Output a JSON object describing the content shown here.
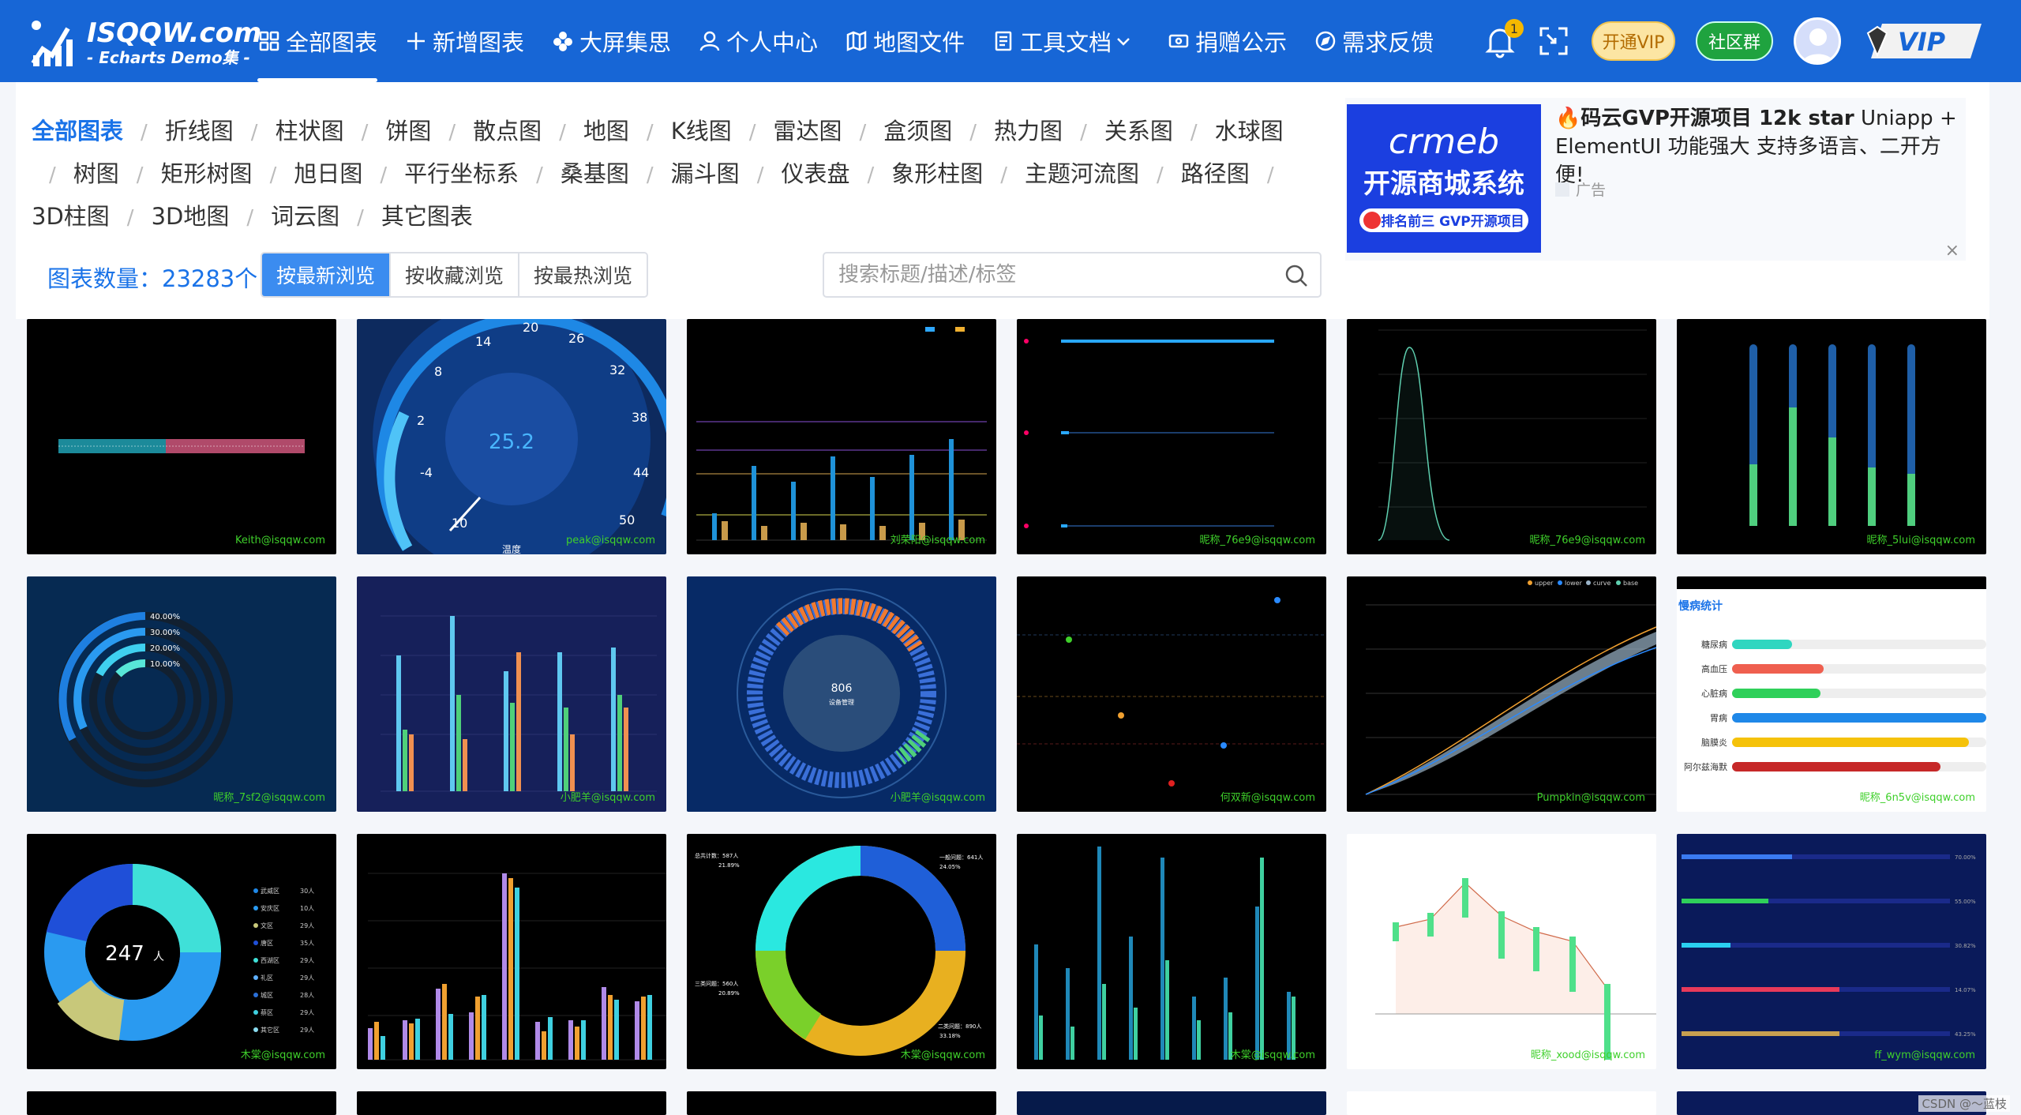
{
  "logo": {
    "title": "ISQQW.com",
    "subtitle": "- Echarts Demo集 -"
  },
  "nav": [
    {
      "label": "全部图表",
      "icon": "grid-icon"
    },
    {
      "label": "新增图表",
      "icon": "plus-icon"
    },
    {
      "label": "大屏集思",
      "icon": "cluster-icon"
    },
    {
      "label": "个人中心",
      "icon": "user-icon"
    },
    {
      "label": "地图文件",
      "icon": "map-icon"
    },
    {
      "label": "工具文档",
      "icon": "doc-icon"
    },
    {
      "label": "捐赠公示",
      "icon": "money-icon"
    },
    {
      "label": "需求反馈",
      "icon": "compass-icon"
    }
  ],
  "header_right": {
    "notif_count": "1",
    "vip_label": "开通VIP",
    "group_label": "社区群",
    "vip_badge": "VIP"
  },
  "categories": [
    "全部图表",
    "折线图",
    "柱状图",
    "饼图",
    "散点图",
    "地图",
    "K线图",
    "雷达图",
    "盒须图",
    "热力图",
    "关系图",
    "水球图",
    "树图",
    "矩形树图",
    "旭日图",
    "平行坐标系",
    "桑基图",
    "漏斗图",
    "仪表盘",
    "象形柱图",
    "主题河流图",
    "路径图",
    "3D柱图",
    "3D地图",
    "词云图",
    "其它图表"
  ],
  "count_label": "图表数量：23283个",
  "sort_tabs": [
    "按最新浏览",
    "按收藏浏览",
    "按最热浏览"
  ],
  "search": {
    "placeholder": "搜索标题/描述/标签"
  },
  "ad": {
    "title_bold": "🔥码云GVP开源项目 12k star",
    "title_rest": " Uniapp + ElementUI 功能强大 支持多语言、二开方便!",
    "label": "广告",
    "img_brand": "crmeb",
    "img_title": "开源商城系统",
    "img_sub": "排名前三 GVP开源项目",
    "close": "×"
  },
  "cards": {
    "c1": {
      "wm": "Keith@isqqw.com"
    },
    "c2": {
      "wm": "peak@isqqw.com",
      "value": "25.2",
      "ticks": [
        "2",
        "8",
        "14",
        "20",
        "26",
        "32",
        "38",
        "44",
        "50",
        "-4",
        "10"
      ],
      "unit": "温度"
    },
    "c3": {
      "wm": "刘荣阳@isqqw.com"
    },
    "c4": {
      "wm": "昵称_76e9@isqqw.com"
    },
    "c5": {
      "wm": "昵称_76e9@isqqw.com"
    },
    "c6": {
      "wm": "昵称_5lui@isqqw.com"
    },
    "c7": {
      "wm": "昵称_7sf2@isqqw.com",
      "labels": [
        "40.00%",
        "30.00%",
        "20.00%",
        "10.00%"
      ]
    },
    "c8": {
      "wm": "小肥羊@isqqw.com"
    },
    "c9": {
      "wm": "小肥羊@isqqw.com",
      "value": "806",
      "sub": "设备管理"
    },
    "c10": {
      "wm": "何双新@isqqw.com"
    },
    "c11": {
      "wm": "Pumpkin@isqqw.com",
      "legend": [
        "upper",
        "lower",
        "curve",
        "base"
      ]
    },
    "c12": {
      "wm": "昵称_6n5v@isqqw.com",
      "title": "慢病统计",
      "items": [
        "糖尿病",
        "高血压",
        "心脏病",
        "胃病",
        "脑膜炎",
        "阿尔兹海默"
      ]
    },
    "c13": {
      "wm": "木棠@isqqw.com",
      "value": "247",
      "unit": "人",
      "legend": [
        "武威区",
        "安庆区",
        "文区",
        "唐区",
        "西湖区",
        "礼区",
        "城区",
        "蔡区",
        "其它区"
      ],
      "nums": [
        "30人",
        "10人",
        "29人",
        "35人",
        "29人",
        "29人",
        "28人",
        "29人",
        "29人"
      ]
    },
    "c14": {
      "wm": ""
    },
    "c15": {
      "wm": "木棠@isqqw.com",
      "l1": "总共计数：587人",
      "p1": "21.89%",
      "l2": "一般问题：641人",
      "p2": "24.05%",
      "l3": "三类问题：560人",
      "p3": "20.89%",
      "l4": "二类问题：890人",
      "p4": "33.18%"
    },
    "c16": {
      "wm": "木棠@isqqw.com"
    },
    "c17": {
      "wm": "昵称_xood@isqqw.com"
    },
    "c18": {
      "wm": "ff_wym@isqqw.com",
      "pcts": [
        "70.00%",
        "55.00%",
        "30.82%",
        "14.07%",
        "43.25%"
      ]
    }
  },
  "footer_note": "CSDN @～蓝枝",
  "colors": {
    "header": "#1766d6",
    "accent": "#1a73e8",
    "wm": "#3fd02b"
  }
}
